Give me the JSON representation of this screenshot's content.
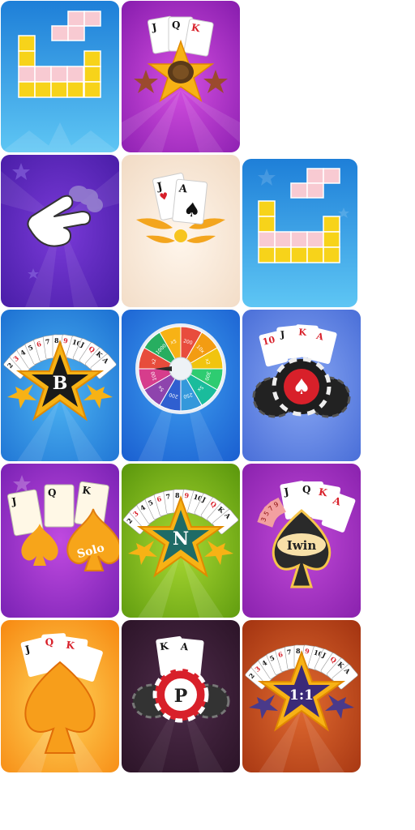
{
  "tiles": [
    {
      "id": "block-puzzle",
      "icon": "block-puzzle-icon",
      "bg": "#2e9ee0"
    },
    {
      "id": "turtle-star",
      "icon": "turtle-star-icon",
      "bg": "#b02ec8"
    },
    {
      "id": "hand-game",
      "icon": "victory-hand-icon",
      "bg": "#5a25b8"
    },
    {
      "id": "blackjack",
      "icon": "blackjack-cards-icon",
      "bg": "#f5e2d2"
    },
    {
      "id": "block-puzzle-2",
      "icon": "block-puzzle-icon",
      "bg": "#2e9ee0"
    },
    {
      "id": "tien-len-b",
      "icon": "star-b-icon",
      "bg": "#2f8fe0",
      "label": "B"
    },
    {
      "id": "lucky-wheel",
      "icon": "lucky-wheel-icon",
      "bg": "#2e84e6"
    },
    {
      "id": "poker-chips",
      "icon": "poker-chips-icon",
      "bg": "#5b82ea"
    },
    {
      "id": "solo",
      "icon": "solo-spade-icon",
      "bg": "#9a2fc6",
      "label": "Solo"
    },
    {
      "id": "tien-len-n",
      "icon": "star-n-icon",
      "bg": "#7fbc18",
      "label": "N"
    },
    {
      "id": "iwin",
      "icon": "iwin-spade-icon",
      "bg": "#a22fbe",
      "label": "Iwin",
      "fan": [
        "3",
        "5",
        "7",
        "9"
      ]
    },
    {
      "id": "orange-spade",
      "icon": "orange-spade-icon",
      "bg": "#f79e1b"
    },
    {
      "id": "poker-p",
      "icon": "poker-chip-p-icon",
      "bg": "#3b1f38",
      "label": "P"
    },
    {
      "id": "one-vs-one",
      "icon": "star-1v1-icon",
      "bg": "#c14a1f",
      "label": "1:1"
    }
  ],
  "cards": {
    "j": "J",
    "q": "Q",
    "k": "K",
    "a": "A",
    "suit_spade": "♠",
    "suit_heart": "♥",
    "fan": [
      "2",
      "3",
      "4",
      "5",
      "6",
      "7",
      "8",
      "9",
      "10",
      "J",
      "Q",
      "K",
      "A"
    ]
  },
  "wheel": {
    "labels": [
      "200",
      "10x",
      "x2",
      "300",
      "5x",
      "250",
      "200",
      "5x",
      "100",
      "x2",
      "1000",
      "x5"
    ]
  },
  "colors": {
    "yellow": "#f6d21a",
    "pink": "#f6c9d2",
    "star_gold": "#f7b215",
    "card_red": "#d8202a"
  }
}
